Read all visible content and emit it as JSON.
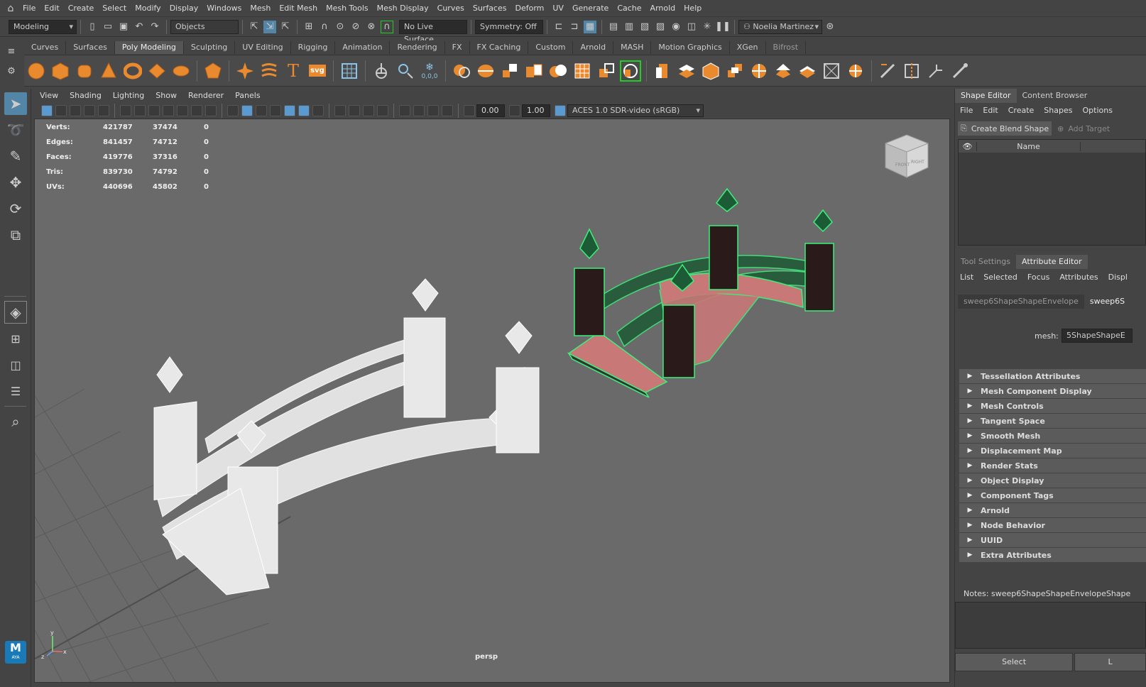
{
  "menu": [
    "File",
    "Edit",
    "Create",
    "Select",
    "Modify",
    "Display",
    "Windows",
    "Mesh",
    "Edit Mesh",
    "Mesh Tools",
    "Mesh Display",
    "Curves",
    "Surfaces",
    "Deform",
    "UV",
    "Generate",
    "Cache",
    "Arnold",
    "Help"
  ],
  "status": {
    "mode": "Modeling",
    "select_mode": "Objects",
    "live_surface": "No Live Surface",
    "symmetry": "Symmetry: Off",
    "user": "Noelia Martinez"
  },
  "shelf_tabs": [
    "Curves",
    "Surfaces",
    "Poly Modeling",
    "Sculpting",
    "UV Editing",
    "Rigging",
    "Animation",
    "Rendering",
    "FX",
    "FX Caching",
    "Custom",
    "Arnold",
    "MASH",
    "Motion Graphics",
    "XGen",
    "Bifrost"
  ],
  "shelf_active": "Poly Modeling",
  "shelf_text_icon": "T",
  "shelf_svg_icon": "svg",
  "shelf_coords": "0,0,0",
  "viewport": {
    "menu": [
      "View",
      "Shading",
      "Lighting",
      "Show",
      "Renderer",
      "Panels"
    ],
    "exposure": "0.00",
    "gamma": "1.00",
    "colorspace": "ACES 1.0 SDR-video (sRGB)",
    "camera": "persp",
    "viewcube_front": "FRONT",
    "viewcube_right": "RIGHT",
    "axis_y": "y",
    "axis_x": "x",
    "axis_z": "z"
  },
  "hud": [
    {
      "label": "Verts:",
      "a": "421787",
      "b": "37474",
      "c": "0"
    },
    {
      "label": "Edges:",
      "a": "841457",
      "b": "74712",
      "c": "0"
    },
    {
      "label": "Faces:",
      "a": "419776",
      "b": "37316",
      "c": "0"
    },
    {
      "label": "Tris:",
      "a": "839730",
      "b": "74792",
      "c": "0"
    },
    {
      "label": "UVs:",
      "a": "440696",
      "b": "45802",
      "c": "0"
    }
  ],
  "logo": "M",
  "logo_sub": "AYA",
  "shape_editor": {
    "tabs": [
      "Shape Editor",
      "Content Browser"
    ],
    "menu": [
      "File",
      "Edit",
      "Create",
      "Shapes",
      "Options"
    ],
    "create_blend": "Create Blend Shape",
    "add_target": "Add Target",
    "col_name": "Name"
  },
  "attr_editor": {
    "tabs": [
      "Tool Settings",
      "Attribute Editor"
    ],
    "menu": [
      "List",
      "Selected",
      "Focus",
      "Attributes",
      "Displ"
    ],
    "node_tabs": [
      "sweep6ShapeShapeEnvelope",
      "sweep6S"
    ],
    "mesh_label": "mesh:",
    "mesh_value": "5ShapeShapeE",
    "sections": [
      "Tessellation Attributes",
      "Mesh Component Display",
      "Mesh Controls",
      "Tangent Space",
      "Smooth Mesh",
      "Displacement Map",
      "Render Stats",
      "Object Display",
      "Component Tags",
      "Arnold",
      "Node Behavior",
      "UUID",
      "Extra Attributes"
    ],
    "notes": "Notes:  sweep6ShapeShapeEnvelopeShape",
    "select_btn": "Select",
    "load_btn": "L"
  }
}
